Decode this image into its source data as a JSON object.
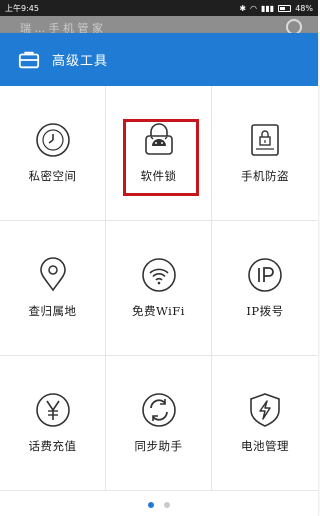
{
  "status_bar": {
    "time": "上午9:45",
    "battery": "48%"
  },
  "background_app": {
    "ghost_title": "瑞 ... 手 机 管 家"
  },
  "dialog": {
    "title": "高级工具",
    "accent_color": "#1f7bd3",
    "highlight_color": "#c4161c",
    "tools": [
      {
        "label": "私密空间",
        "icon": "clock-icon"
      },
      {
        "label": "软件锁",
        "icon": "app-lock-icon",
        "highlighted": true
      },
      {
        "label": "手机防盗",
        "icon": "phone-lock-icon"
      },
      {
        "label": "查归属地",
        "icon": "location-pin-icon"
      },
      {
        "label": "免费WiFi",
        "icon": "wifi-icon"
      },
      {
        "label": "IP拨号",
        "icon": "ip-icon"
      },
      {
        "label": "话费充值",
        "icon": "yen-icon"
      },
      {
        "label": "同步助手",
        "icon": "sync-icon"
      },
      {
        "label": "电池管理",
        "icon": "battery-shield-icon"
      }
    ],
    "pager": {
      "pages": 2,
      "current": 1
    }
  }
}
